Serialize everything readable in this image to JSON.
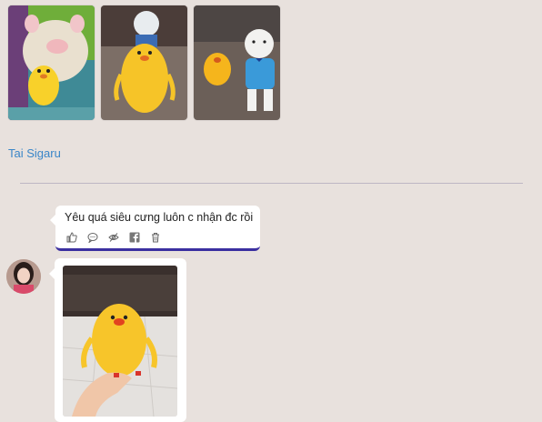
{
  "gallery": {
    "images": [
      {
        "alt": "pig plush with yellow duck cup"
      },
      {
        "alt": "yellow duck cup with doll"
      },
      {
        "alt": "duck cup and doll in blue overalls"
      }
    ]
  },
  "post": {
    "author": "Tai Sigaru"
  },
  "comment": {
    "text": "Yêu quá siêu cưng luôn c nhận đc rồi",
    "actions": [
      "like-icon",
      "reply-icon",
      "hide-icon",
      "facebook-icon",
      "delete-icon"
    ]
  },
  "reply": {
    "photo_alt": "hand holding yellow duck cup"
  },
  "colors": {
    "background": "#e8e1dd",
    "link": "#3a86c8",
    "divider": "#bdb6c4",
    "bubble_underline": "#3b2fa0",
    "duck_yellow": "#f7c52a"
  }
}
